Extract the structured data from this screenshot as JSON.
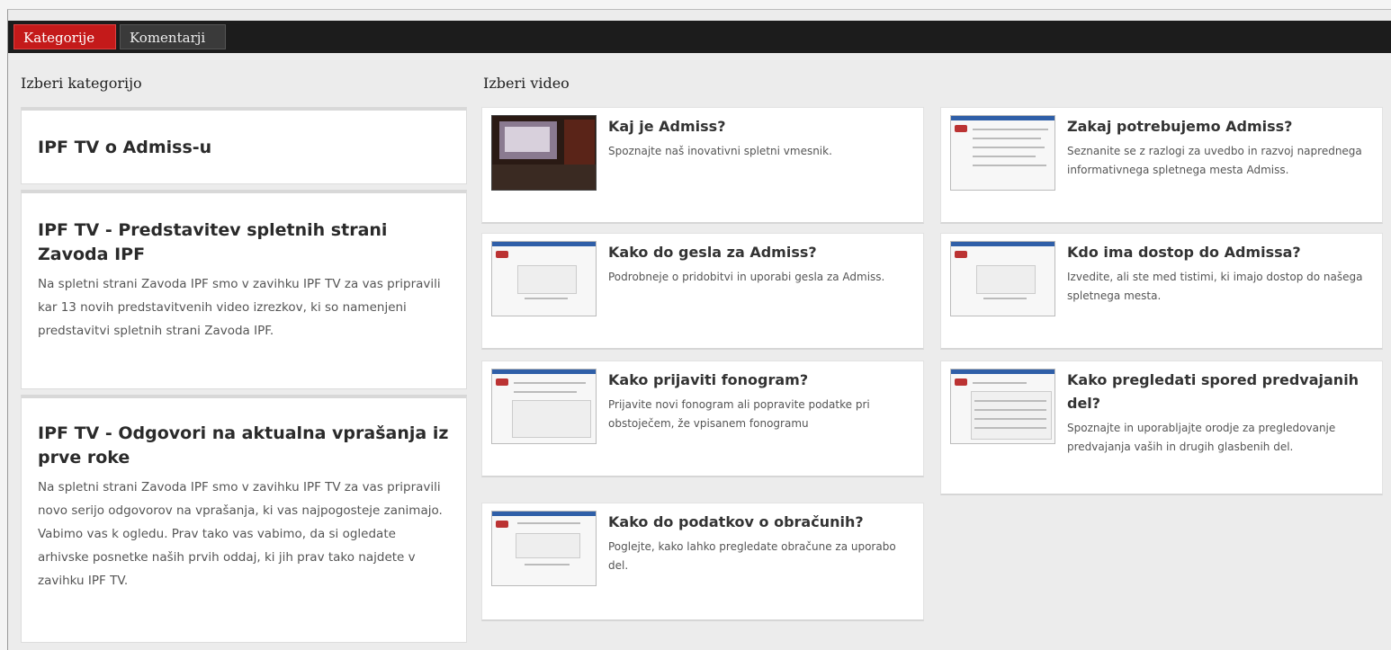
{
  "tabs": [
    {
      "label": "Kategorije",
      "active": true
    },
    {
      "label": "Komentarji",
      "active": false
    }
  ],
  "categories": {
    "heading": "Izberi kategorijo",
    "items": [
      {
        "title": "IPF TV o Admiss-u",
        "description": ""
      },
      {
        "title": "IPF TV - Predstavitev spletnih strani Zavoda IPF",
        "description": "Na spletni strani Zavoda IPF smo v zavihku IPF TV za vas pripravili kar 13 novih predstavitvenih video izrezkov, ki so namenjeni predstavitvi spletnih strani Zavoda IPF."
      },
      {
        "title": "IPF TV - Odgovori na aktualna vprašanja iz prve roke",
        "description": "Na spletni strani Zavoda IPF smo v zavihku IPF TV za vas pripravili novo serijo odgovorov na vprašanja, ki vas najpogosteje zanimajo. Vabimo vas k ogledu. Prav tako vas vabimo, da si ogledate arhivske posnetke naših prvih oddaj, ki jih prav tako najdete v zavihku IPF TV."
      }
    ]
  },
  "videos": {
    "heading": "Izberi video",
    "items": [
      {
        "title": "Kaj je Admiss?",
        "description": "Spoznajte naš inovativni spletni vmesnik."
      },
      {
        "title": "Zakaj potrebujemo Admiss?",
        "description": "Seznanite se z razlogi za uvedbo in razvoj naprednega informativnega spletnega mesta Admiss."
      },
      {
        "title": "Kako do gesla za Admiss?",
        "description": "Podrobneje o pridobitvi in uporabi gesla za Admiss."
      },
      {
        "title": "Kdo ima dostop do Admissa?",
        "description": "Izvedite, ali ste med tistimi, ki imajo dostop do našega spletnega mesta."
      },
      {
        "title": "Kako prijaviti fonogram?",
        "description": "Prijavite novi fonogram ali popravite podatke pri obstoječem, že vpisanem fonogramu"
      },
      {
        "title": "Kako pregledati spored predvajanih del?",
        "description": "Spoznajte in uporabljajte orodje za pregledovanje predvajanja vaših in drugih glasbenih del."
      },
      {
        "title": "Kako do podatkov o obračunih?",
        "description": "Poglejte, kako lahko pregledate obračune za uporabo del."
      }
    ]
  },
  "colors": {
    "tab_active": "#c41a1a",
    "tabbar": "#1c1c1c",
    "thumb_header": "#2f5fa8"
  }
}
